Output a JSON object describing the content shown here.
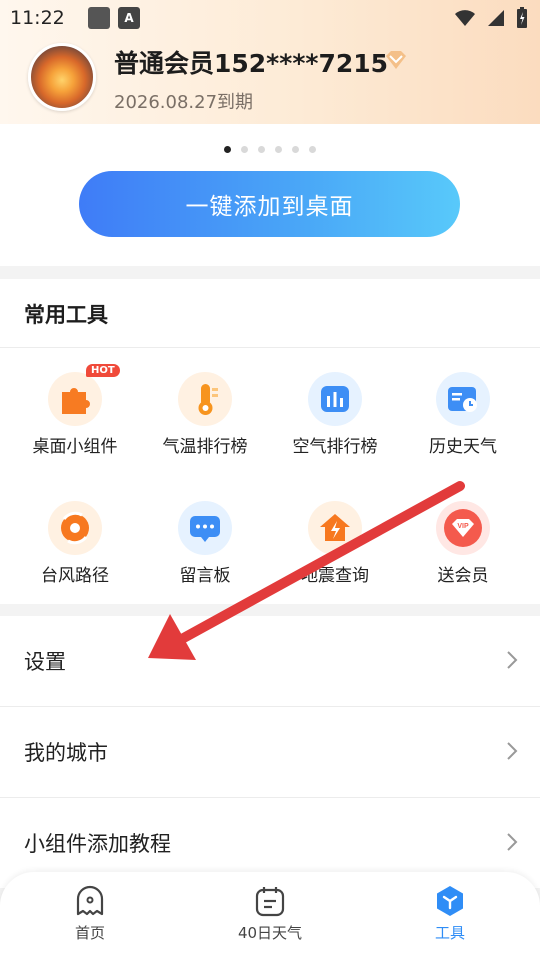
{
  "status_bar": {
    "time": "11:22",
    "a_icon_text": "A"
  },
  "header": {
    "member_name": "普通会员152****7215",
    "expire_text": "2026.08.27到期"
  },
  "banner": {
    "dots_count": 6,
    "active_dot": 0,
    "add_button_label": "一键添加到桌面"
  },
  "tools": {
    "title": "常用工具",
    "items": [
      {
        "label": "桌面小组件",
        "icon": "puzzle-icon",
        "badge": "HOT"
      },
      {
        "label": "气温排行榜",
        "icon": "thermometer-icon"
      },
      {
        "label": "空气排行榜",
        "icon": "bar-chart-icon"
      },
      {
        "label": "历史天气",
        "icon": "calendar-clock-icon"
      },
      {
        "label": "台风路径",
        "icon": "typhoon-icon"
      },
      {
        "label": "留言板",
        "icon": "message-board-icon"
      },
      {
        "label": "地震查询",
        "icon": "earthquake-icon"
      },
      {
        "label": "送会员",
        "icon": "vip-gift-icon"
      }
    ]
  },
  "menu": [
    {
      "label": "设置"
    },
    {
      "label": "我的城市"
    },
    {
      "label": "小组件添加教程"
    }
  ],
  "tabbar": {
    "tabs": [
      {
        "label": "首页",
        "icon": "home-ghost-icon"
      },
      {
        "label": "40日天气",
        "icon": "calendar-icon"
      },
      {
        "label": "工具",
        "icon": "tools-hexagon-icon",
        "active": true
      }
    ]
  },
  "colors": {
    "accent": "#2f8df6",
    "button_gradient_start": "#3f7cf7",
    "button_gradient_end": "#58c9fa",
    "arrow": "#e23b3b",
    "hot_badge": "#f04a3a"
  }
}
